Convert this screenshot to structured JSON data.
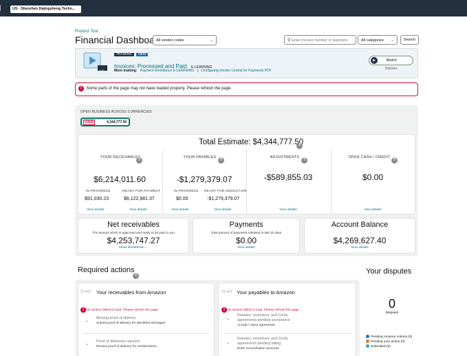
{
  "header": {
    "account": "US - Shenzhen Dajingsheng Techn..."
  },
  "page": {
    "breadcrumb": "Product Tour",
    "title": "Financial Dashboard",
    "vendor_select": "All vendor codes",
    "search_placeholder": "Enter invoice number or payment",
    "category_select": "All categories",
    "search_button": "Search"
  },
  "training": {
    "badge_training": "TRAINING",
    "badge_new": "NEW",
    "title": "Invoices: Processed and Paid",
    "subtitle": "E-LEARNING",
    "more_label": "More training:",
    "link1": "Payment Remittance E-LEARNING",
    "separator": "|",
    "link2": "Configuring Vendor Central for Payments PDF",
    "thumb_time": "1:00",
    "watch": "Watch",
    "dismiss": "Dismiss"
  },
  "alert": {
    "text": "Some parts of the page may not have loaded properly. Please refresh the page."
  },
  "open_business": {
    "heading": "OPEN BUSINESS ACROSS CURRENCIES",
    "currency": "USD",
    "currency_amount": "4,344,777.50"
  },
  "estimate": {
    "label": "Total Estimate: $4,344,777.50"
  },
  "columns": {
    "receivables": {
      "label": "YOUR RECEIVABLES",
      "value": "$6,214,011.60",
      "sub1_label": "IN PROGRESS",
      "sub1_value": "$91,030.23",
      "sub2_label": "READY FOR PAYMENT",
      "sub2_value": "$6,122,981.37",
      "link1": "View details",
      "link2": "View details"
    },
    "payables": {
      "label": "YOUR PAYABLES",
      "value": "-$1,279,379.07",
      "sub1_label": "IN PROGRESS",
      "sub1_value": "$0.00",
      "sub2_label": "READY FOR DEDUCTION",
      "sub2_value": "-$1,279,379.07",
      "link1": "View details",
      "link2": "View details"
    },
    "adjustments": {
      "label": "ADJUSTMENTS",
      "value": "-$589,855.03",
      "link": "View details"
    },
    "open_cash": {
      "label": "OPEN CASH / CREDIT",
      "value": "$0.00",
      "link": "View details"
    }
  },
  "summary": {
    "net": {
      "title": "Net receivables",
      "desc": "The amount which is approved and ready to be paid to you",
      "value": "$4,253,747.27",
      "link": "Show Breakdown"
    },
    "payments": {
      "title": "Payments",
      "desc": "Total amount of payments released in last 15 days",
      "value": "$0.00",
      "link": "View details"
    },
    "balance": {
      "title": "Account Balance",
      "value": "$4,269,627.40",
      "link": "View details"
    }
  },
  "required": {
    "title": "Required actions",
    "receivables_panel": {
      "title": "Your receivables from Amazon",
      "error": "his section failed to load. Please refresh the page.",
      "items": [
        {
          "title": "Missing proof of delivery",
          "sub": "Submit proof of delivery for identified shortages"
        },
        {
          "title": "Proof of deliveries rejected",
          "sub": "Review proof of delivery for resubmission"
        }
      ]
    },
    "payables_panel": {
      "title": "Your payables to Amazon",
      "error": "his section failed to load. Please refresh the page.",
      "items": [
        {
          "title1": "Rebates, incentives, and CoOp",
          "title2": "agreements pending acceptance",
          "sub": "Accept / reject agreement"
        },
        {
          "title1": "Rebates, incentives, and CoOp",
          "title2": "agreements pending billing",
          "sub": "Enter reconciliation amounts"
        }
      ]
    }
  },
  "disputes": {
    "title": "Your disputes",
    "count": "0",
    "count_label": "Disputes",
    "legend": [
      {
        "label": "Pending Amazon Actions (0)",
        "color": "#1a73c9"
      },
      {
        "label": "Pending your action (0)",
        "color": "#e8731a"
      },
      {
        "label": "Submitted (0)",
        "color": "#36a3d9"
      }
    ]
  }
}
